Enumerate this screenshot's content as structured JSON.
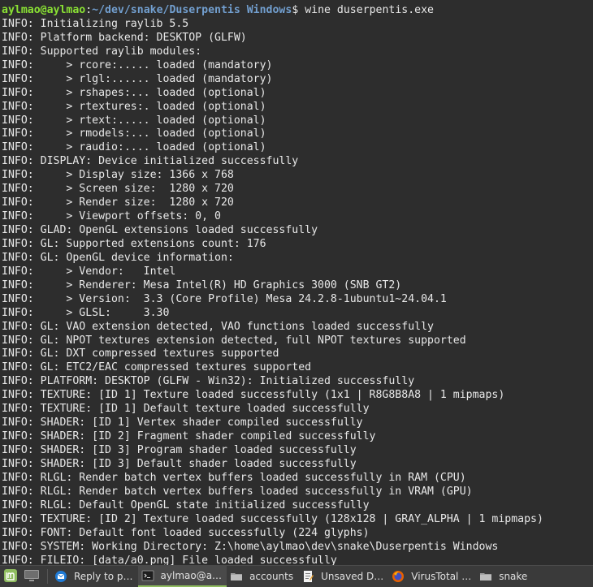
{
  "prompt": {
    "user_host": "aylmao@aylmao",
    "separator": ":",
    "path": "~/dev/snake/Duserpentis Windows",
    "symbol": "$ ",
    "command": "wine duserpentis.exe"
  },
  "log_lines": [
    "INFO: Initializing raylib 5.5",
    "INFO: Platform backend: DESKTOP (GLFW)",
    "INFO: Supported raylib modules:",
    "INFO:     > rcore:..... loaded (mandatory)",
    "INFO:     > rlgl:...... loaded (mandatory)",
    "INFO:     > rshapes:... loaded (optional)",
    "INFO:     > rtextures:. loaded (optional)",
    "INFO:     > rtext:..... loaded (optional)",
    "INFO:     > rmodels:... loaded (optional)",
    "INFO:     > raudio:.... loaded (optional)",
    "INFO: DISPLAY: Device initialized successfully",
    "INFO:     > Display size: 1366 x 768",
    "INFO:     > Screen size:  1280 x 720",
    "INFO:     > Render size:  1280 x 720",
    "INFO:     > Viewport offsets: 0, 0",
    "INFO: GLAD: OpenGL extensions loaded successfully",
    "INFO: GL: Supported extensions count: 176",
    "INFO: GL: OpenGL device information:",
    "INFO:     > Vendor:   Intel",
    "INFO:     > Renderer: Mesa Intel(R) HD Graphics 3000 (SNB GT2)",
    "INFO:     > Version:  3.3 (Core Profile) Mesa 24.2.8-1ubuntu1~24.04.1",
    "INFO:     > GLSL:     3.30",
    "INFO: GL: VAO extension detected, VAO functions loaded successfully",
    "INFO: GL: NPOT textures extension detected, full NPOT textures supported",
    "INFO: GL: DXT compressed textures supported",
    "INFO: GL: ETC2/EAC compressed textures supported",
    "INFO: PLATFORM: DESKTOP (GLFW - Win32): Initialized successfully",
    "INFO: TEXTURE: [ID 1] Texture loaded successfully (1x1 | R8G8B8A8 | 1 mipmaps)",
    "INFO: TEXTURE: [ID 1] Default texture loaded successfully",
    "INFO: SHADER: [ID 1] Vertex shader compiled successfully",
    "INFO: SHADER: [ID 2] Fragment shader compiled successfully",
    "INFO: SHADER: [ID 3] Program shader loaded successfully",
    "INFO: SHADER: [ID 3] Default shader loaded successfully",
    "INFO: RLGL: Render batch vertex buffers loaded successfully in RAM (CPU)",
    "INFO: RLGL: Render batch vertex buffers loaded successfully in VRAM (GPU)",
    "INFO: RLGL: Default OpenGL state initialized successfully",
    "INFO: TEXTURE: [ID 2] Texture loaded successfully (128x128 | GRAY_ALPHA | 1 mipmaps)",
    "INFO: FONT: Default font loaded successfully (224 glyphs)",
    "INFO: SYSTEM: Working Directory: Z:\\home\\aylmao\\dev\\snake\\Duserpentis Windows",
    "INFO: FILEIO: [data/a0.png] File loaded successfully"
  ],
  "colors": {
    "terminal_bg": "#2d2d2d",
    "prompt_user": "#8ae234",
    "prompt_path": "#729fcf",
    "text": "#e8e8e8",
    "taskbar_bg": "#3a3a3a",
    "mint_green": "#8fbc5f"
  },
  "taskbar": {
    "launchers": [
      {
        "icon": "linux-mint-menu-icon"
      },
      {
        "icon": "show-desktop-icon"
      }
    ],
    "tasks": [
      {
        "label": "Reply to p…",
        "icon": "thunderbird-icon",
        "active": false
      },
      {
        "label": "aylmao@a…",
        "icon": "terminal-icon",
        "active": true
      },
      {
        "label": "accounts",
        "icon": "folder-icon",
        "active": false
      },
      {
        "label": "Unsaved D…",
        "icon": "text-editor-icon",
        "active": false
      },
      {
        "label": "VirusTotal …",
        "icon": "firefox-icon",
        "active": false
      },
      {
        "label": "snake",
        "icon": "folder-icon",
        "active": false
      }
    ]
  }
}
